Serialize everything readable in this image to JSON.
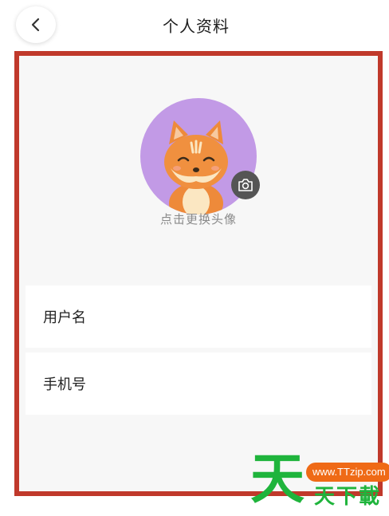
{
  "header": {
    "title": "个人资料"
  },
  "profile": {
    "avatar_hint": "点击更换头像"
  },
  "fields": [
    {
      "label": "用户名"
    },
    {
      "label": "手机号"
    }
  ],
  "watermark": {
    "logo_text": "天天下载",
    "url": "www.TTzip.com"
  },
  "colors": {
    "highlight_border": "#c0392b",
    "avatar_bg": "#c29ae6",
    "watermark_green": "#1fb43c",
    "watermark_orange": "#ef6a16"
  },
  "icons": {
    "back": "chevron-left-icon",
    "camera": "camera-icon"
  }
}
